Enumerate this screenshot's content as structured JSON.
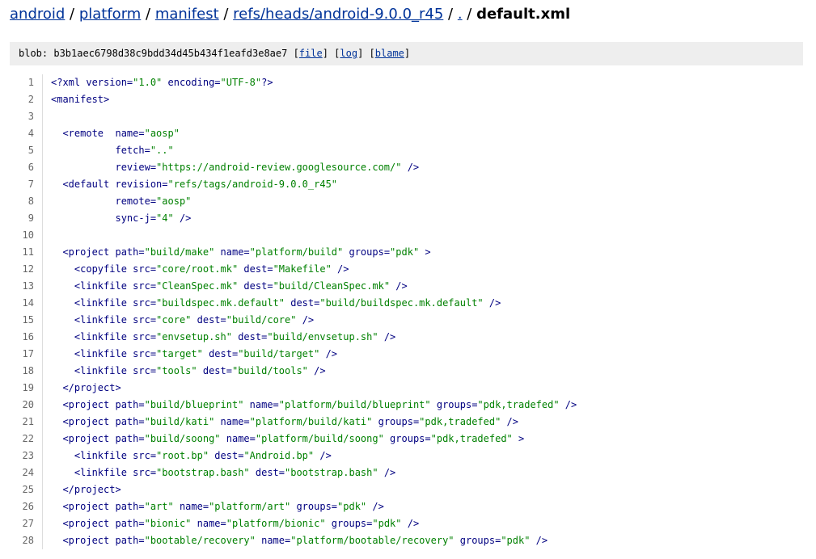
{
  "breadcrumb": {
    "items": [
      "android",
      "platform",
      "manifest",
      "refs/heads/android-9.0.0_r45",
      "."
    ],
    "current": "default.xml"
  },
  "blob": {
    "prefix": "blob:",
    "hash": "b3b1aec6798d38c9bdd34d45b434f1eafd3e8ae7",
    "links": [
      "file",
      "log",
      "blame"
    ]
  },
  "lines": [
    "<?xml version=\"1.0\" encoding=\"UTF-8\"?>",
    "<manifest>",
    "",
    "  <remote  name=\"aosp\"",
    "           fetch=\"..\"",
    "           review=\"https://android-review.googlesource.com/\" />",
    "  <default revision=\"refs/tags/android-9.0.0_r45\"",
    "           remote=\"aosp\"",
    "           sync-j=\"4\" />",
    "",
    "  <project path=\"build/make\" name=\"platform/build\" groups=\"pdk\" >",
    "    <copyfile src=\"core/root.mk\" dest=\"Makefile\" />",
    "    <linkfile src=\"CleanSpec.mk\" dest=\"build/CleanSpec.mk\" />",
    "    <linkfile src=\"buildspec.mk.default\" dest=\"build/buildspec.mk.default\" />",
    "    <linkfile src=\"core\" dest=\"build/core\" />",
    "    <linkfile src=\"envsetup.sh\" dest=\"build/envsetup.sh\" />",
    "    <linkfile src=\"target\" dest=\"build/target\" />",
    "    <linkfile src=\"tools\" dest=\"build/tools\" />",
    "  </project>",
    "  <project path=\"build/blueprint\" name=\"platform/build/blueprint\" groups=\"pdk,tradefed\" />",
    "  <project path=\"build/kati\" name=\"platform/build/kati\" groups=\"pdk,tradefed\" />",
    "  <project path=\"build/soong\" name=\"platform/build/soong\" groups=\"pdk,tradefed\" >",
    "    <linkfile src=\"root.bp\" dest=\"Android.bp\" />",
    "    <linkfile src=\"bootstrap.bash\" dest=\"bootstrap.bash\" />",
    "  </project>",
    "  <project path=\"art\" name=\"platform/art\" groups=\"pdk\" />",
    "  <project path=\"bionic\" name=\"platform/bionic\" groups=\"pdk\" />",
    "  <project path=\"bootable/recovery\" name=\"platform/bootable/recovery\" groups=\"pdk\" />"
  ]
}
